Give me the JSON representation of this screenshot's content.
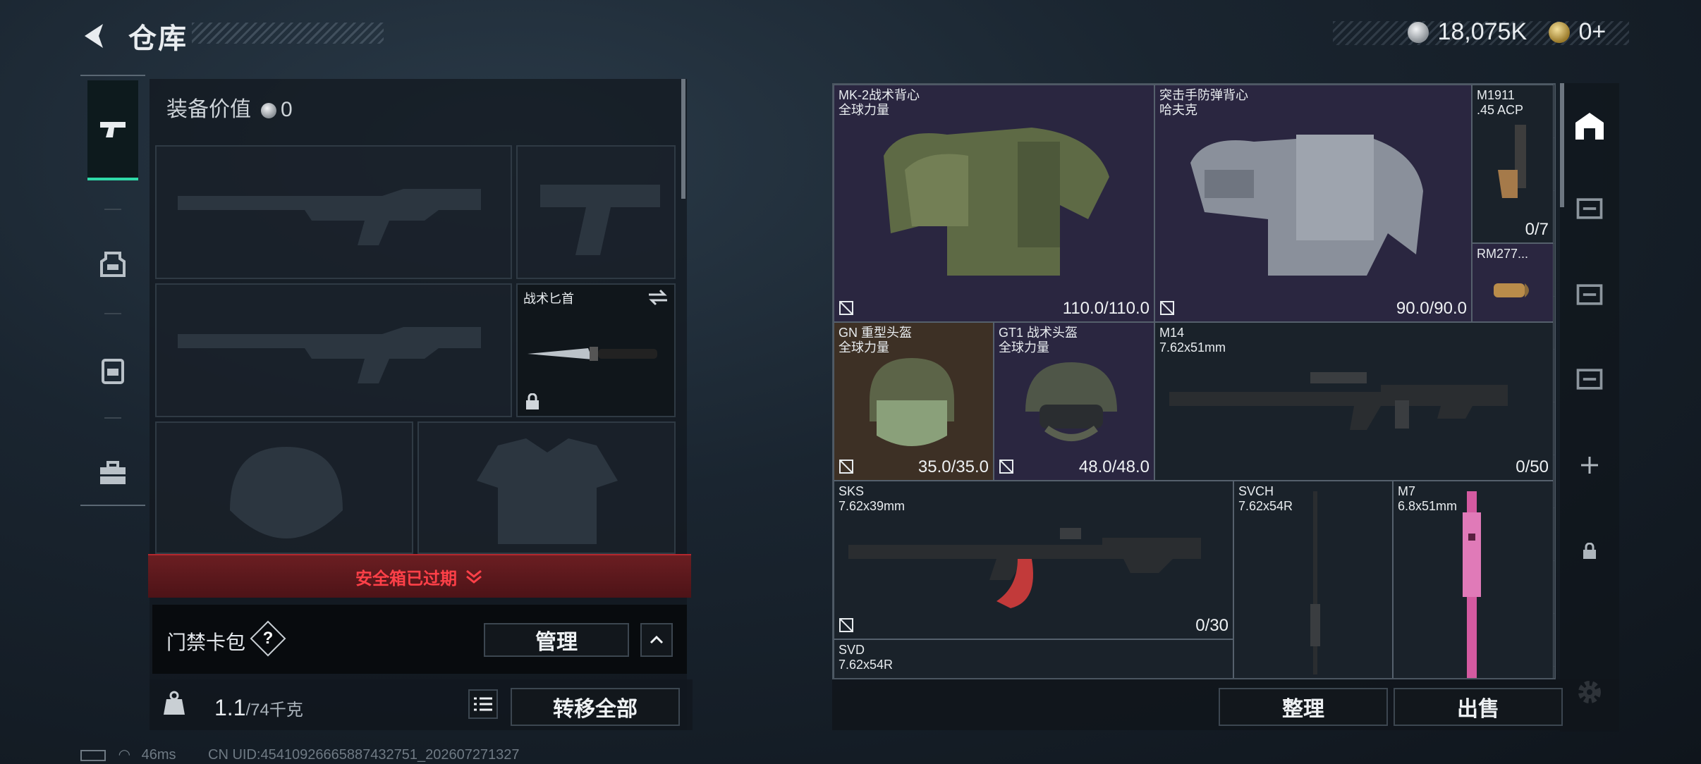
{
  "header": {
    "title": "仓库"
  },
  "currency": {
    "silver": "18,075K",
    "gold": "0+"
  },
  "left_tabs": [
    {
      "id": "weapons",
      "icon": "pistol-icon",
      "active": true
    },
    {
      "id": "chest",
      "icon": "chest-rig-icon",
      "active": false
    },
    {
      "id": "backpack",
      "icon": "backpack-icon",
      "active": false
    },
    {
      "id": "case",
      "icon": "briefcase-icon",
      "active": false
    }
  ],
  "loadout": {
    "equip_value_label": "装备价值",
    "equip_value": "0",
    "melee_label": "战术匕首",
    "secure_case_expired": "安全箱已过期",
    "keycard_label": "门禁卡包",
    "keycard_help": "?",
    "manage_button": "管理",
    "weight_value": "1.1",
    "weight_capacity": "/74千克",
    "transfer_all_button": "转移全部"
  },
  "stash_items": [
    {
      "key": "vest1",
      "name": "MK-2战术背心\n全球力量",
      "durability": "110.0/110.0",
      "bg": "purple"
    },
    {
      "key": "vest2",
      "name": "突击手防弹背心\n哈夫克",
      "durability": "90.0/90.0",
      "bg": "purple"
    },
    {
      "key": "pistol",
      "name": "M1911\n.45 ACP",
      "durability": "0/7",
      "bg": "plain"
    },
    {
      "key": "ammo",
      "name": "RM277...",
      "durability": "",
      "bg": "purple"
    },
    {
      "key": "helmet1",
      "name": "GN 重型头盔\n全球力量",
      "durability": "35.0/35.0",
      "bg": "brown"
    },
    {
      "key": "helmet2",
      "name": "GT1 战术头盔\n全球力量",
      "durability": "48.0/48.0",
      "bg": "purple"
    },
    {
      "key": "m14",
      "name": "M14\n7.62x51mm",
      "durability": "0/50",
      "bg": "plain"
    },
    {
      "key": "sks",
      "name": "SKS\n7.62x39mm",
      "durability": "0/30",
      "bg": "plain"
    },
    {
      "key": "svch",
      "name": "SVCH\n7.62x54R",
      "durability": "",
      "bg": "plain"
    },
    {
      "key": "m7",
      "name": "M7\n6.8x51mm",
      "durability": "",
      "bg": "plain"
    },
    {
      "key": "svd",
      "name": "SVD\n7.62x54R",
      "durability": "",
      "bg": "plain"
    }
  ],
  "stash_buttons": {
    "sort": "整理",
    "sell": "出售"
  },
  "status": {
    "ping": "46ms",
    "uid": "CN UID:45410926665887432751_202607271327"
  },
  "colors": {
    "accent": "#2fd9a8",
    "warning": "#ff4048",
    "rarity_purple": "#2a2640",
    "rarity_brown": "#3d3025"
  }
}
